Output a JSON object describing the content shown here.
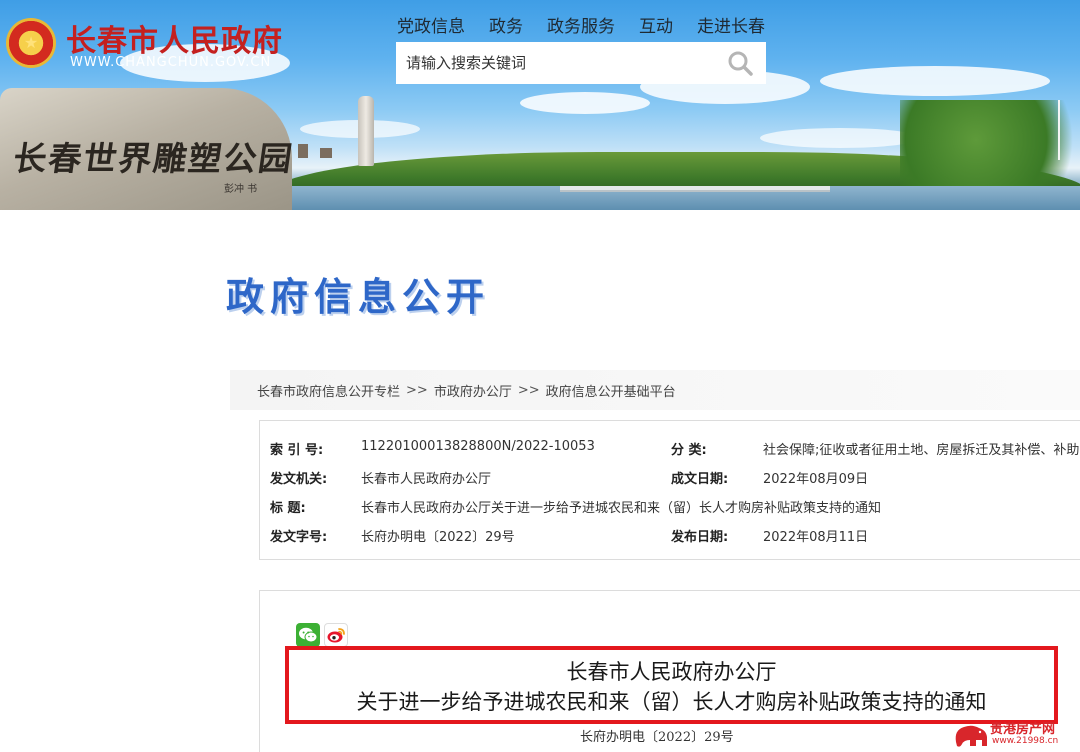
{
  "header": {
    "site_title": "长春市人民政府",
    "site_url": "WWW.CHANGCHUN.GOV.CN",
    "emblem_icon": "national-emblem-icon",
    "nav": [
      "党政信息",
      "政务",
      "政务服务",
      "互动",
      "走进长春"
    ],
    "search": {
      "placeholder": "请输入搜索关键词",
      "icon": "search-icon"
    },
    "banner": {
      "stone_inscription": "长春世界雕塑公园",
      "stone_signature": "彭冲 书"
    }
  },
  "section_title": "政府信息公开",
  "breadcrumb": {
    "items": [
      "长春市政府信息公开专栏",
      "市政府办公厅",
      "政府信息公开基础平台"
    ],
    "separator": ">>"
  },
  "meta": {
    "index_label": "索 引 号:",
    "index_value": "11220100013828800N/2022-10053",
    "category_label": "分    类:",
    "category_value": "社会保障;征收或者征用土地、房屋拆迁及其补偿、补助",
    "issuer_label": "发文机关:",
    "issuer_value": "长春市人民政府办公厅",
    "created_label": "成文日期:",
    "created_value": "2022年08月09日",
    "title_label": "标      题:",
    "title_value": "长春市人民政府办公厅关于进一步给予进城农民和来（留）长人才购房补贴政策支持的通知",
    "doc_no_label": "发文字号:",
    "doc_no_value": "长府办明电〔2022〕29号",
    "published_label": "发布日期:",
    "published_value": "2022年08月11日"
  },
  "article": {
    "share_icons": [
      "wechat-icon",
      "weibo-icon"
    ],
    "org": "长春市人民政府办公厅",
    "title": "关于进一步给予进城农民和来（留）长人才购房补贴政策支持的通知",
    "doc_number": "长府办明电〔2022〕29号"
  },
  "watermark": {
    "name": "贵港房产网",
    "url": "www.21998.cn"
  },
  "colors": {
    "brand_red": "#c4201f",
    "title_blue": "#2e67c8",
    "highlight_red": "#e3181d"
  }
}
